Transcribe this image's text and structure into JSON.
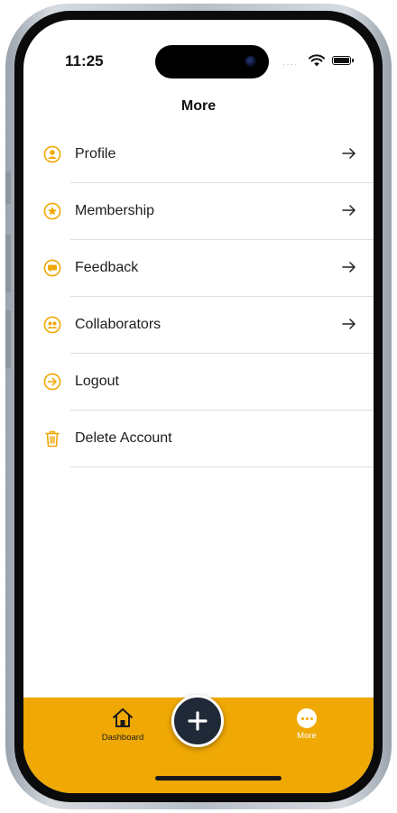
{
  "status_bar": {
    "time": "11:25",
    "signal_dots": "····"
  },
  "header": {
    "title": "More"
  },
  "menu": {
    "items": [
      {
        "label": "Profile",
        "icon": "profile-icon",
        "has_arrow": true
      },
      {
        "label": "Membership",
        "icon": "star-badge-icon",
        "has_arrow": true
      },
      {
        "label": "Feedback",
        "icon": "chat-bubble-icon",
        "has_arrow": true
      },
      {
        "label": "Collaborators",
        "icon": "users-icon",
        "has_arrow": true
      },
      {
        "label": "Logout",
        "icon": "logout-arrow-icon",
        "has_arrow": false
      },
      {
        "label": "Delete Account",
        "icon": "trash-icon",
        "has_arrow": false
      }
    ]
  },
  "tabbar": {
    "dashboard_label": "Dashboard",
    "more_label": "More",
    "active_tab": "More"
  },
  "colors": {
    "accent": "#efa804",
    "fab": "#1f2937",
    "text": "#1d1d1f"
  }
}
